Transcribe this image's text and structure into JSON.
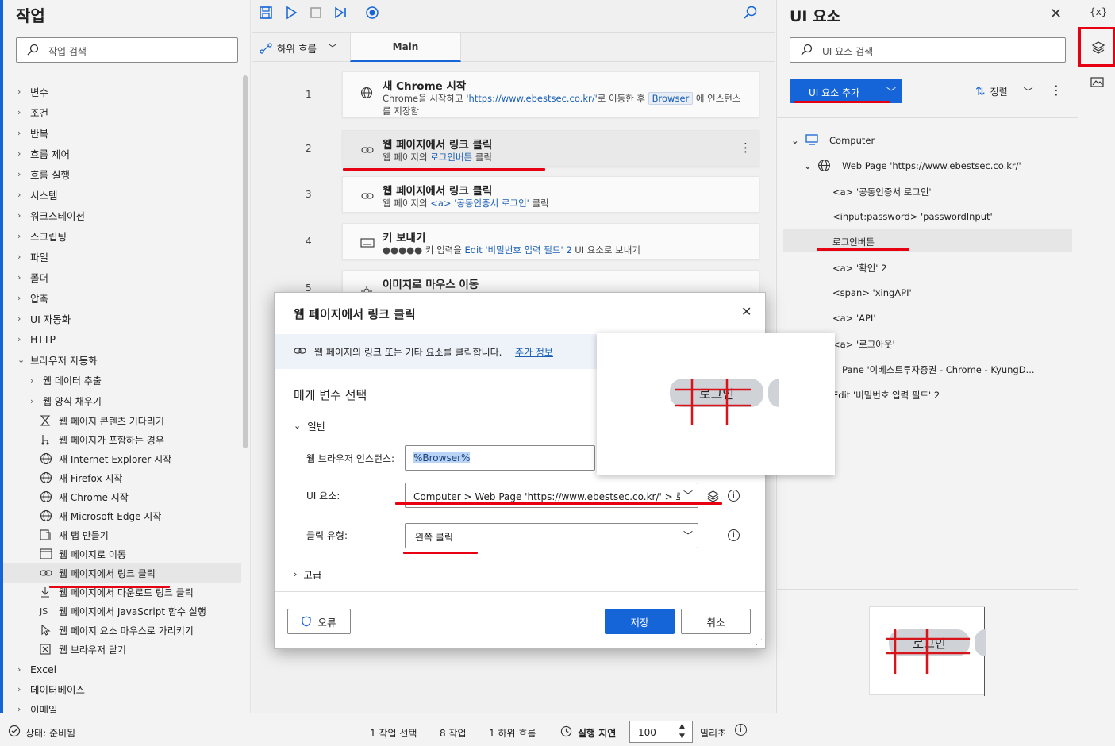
{
  "left_panel": {
    "title": "작업",
    "search_placeholder": "작업 검색",
    "categories": [
      "변수",
      "조건",
      "반복",
      "흐름 제어",
      "흐름 실행",
      "시스템",
      "워크스테이션",
      "스크립팅",
      "파일",
      "폴더",
      "압축",
      "UI 자동화",
      "HTTP",
      "브라우저 자동화"
    ],
    "browser_sub": [
      "웹 데이터 추출",
      "웹 양식 채우기"
    ],
    "browser_actions": [
      "웹 페이지 콘텐츠 기다리기",
      "웹 페이지가 포함하는 경우",
      "새 Internet Explorer 시작",
      "새 Firefox 시작",
      "새 Chrome 시작",
      "새 Microsoft Edge 시작",
      "새 탭 만들기",
      "웹 페이지로 이동",
      "웹 페이지에서 링크 클릭",
      "웹 페이지에서 다운로드 링크 클릭",
      "웹 페이지에서 JavaScript 함수 실행",
      "웹 페이지 요소 마우스로 가리키기",
      "웹 브라우저 닫기"
    ],
    "js_label": "JS",
    "after": [
      "Excel",
      "데이터베이스",
      "이메일"
    ]
  },
  "middle_panel": {
    "subflow_label": "하위 흐름",
    "main_tab": "Main",
    "steps": [
      {
        "num": "1",
        "title": "새 Chrome 시작",
        "desc_pre": "Chrome을 시작하고 ",
        "desc_link": "'https://www.ebestsec.co.kr/'",
        "desc_mid": "로 이동한 후 ",
        "desc_tag": "Browser",
        "desc_post": " 에 인스턴스를 저장함"
      },
      {
        "num": "2",
        "title": "웹 페이지에서 링크 클릭",
        "desc_pre": "웹 페이지의 ",
        "desc_link": "로그인버튼",
        "desc_post": " 클릭"
      },
      {
        "num": "3",
        "title": "웹 페이지에서 링크 클릭",
        "desc_pre": "웹 페이지의 ",
        "desc_link": "<a> '공동인증서 로그인'",
        "desc_post": " 클릭"
      },
      {
        "num": "4",
        "title": "키 보내기",
        "desc_pre": "●●●●● 키 입력을 ",
        "desc_link": "Edit '비밀번호 입력 필드' 2",
        "desc_post": " UI 요소로 보내기"
      },
      {
        "num": "5",
        "title": "이미지로 마우스 이동",
        "desc_pre": "",
        "desc_link": "",
        "desc_post": ""
      }
    ]
  },
  "right_panel": {
    "title": "UI 요소",
    "search_placeholder": "UI 요소 검색",
    "add_button": "UI 요소 추가",
    "sort_label": "정렬",
    "tree": {
      "computer": "Computer",
      "webpage": "Web Page 'https://www.ebestsec.co.kr/'",
      "items": [
        "<a> '공동인증서 로그인'",
        "<input:password> 'passwordInput'",
        "로그인버튼",
        "<a> '확인' 2",
        "<span> 'xingAPI'",
        "<a> 'API'",
        "<a> '로그아웃'"
      ],
      "pane": "Pane '이베스트투자증권 - Chrome - KyungD...",
      "edit": "Edit '비밀번호 입력 필드' 2"
    },
    "preview_text": "로그인"
  },
  "rail": {
    "variables_label": "{x}"
  },
  "dialog": {
    "title": "웹 페이지에서 링크 클릭",
    "info_text": "웹 페이지의 링크 또는 기타 요소를 클릭합니다.",
    "info_link": "추가 정보",
    "section_title": "매개 변수 선택",
    "general_label": "일반",
    "browser_label": "웹 브라우저 인스턴스:",
    "browser_value": "%Browser%",
    "ui_label": "UI 요소:",
    "ui_value": "Computer > Web Page 'https://www.ebestsec.co.kr/' > 로그인",
    "click_label": "클릭 유형:",
    "click_value": "왼쪽 클릭",
    "advanced_label": "고급",
    "error_button": "오류",
    "save_button": "저장",
    "cancel_button": "취소",
    "preview_text": "로그인"
  },
  "status_bar": {
    "status": "상태: 준비됨",
    "selected": "1 작업 선택",
    "actions": "8 작업",
    "subflows": "1 하위 흐름",
    "delay_label": "실행 지연",
    "delay_value": "100",
    "unit": "밀리초"
  },
  "colors": {
    "accent": "#1565d8",
    "highlight": "#e60012",
    "link": "#1a5fb4"
  }
}
